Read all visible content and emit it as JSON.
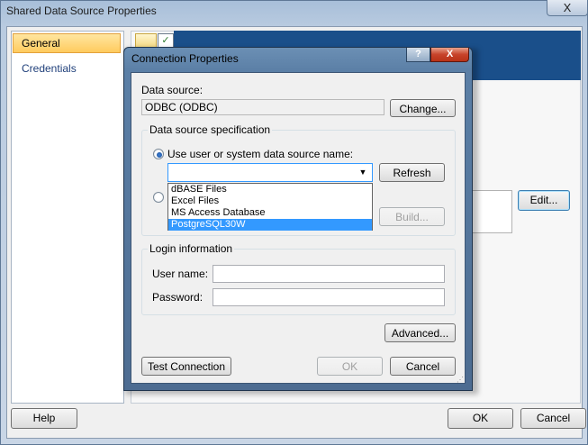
{
  "outer": {
    "title": "Shared Data Source Properties",
    "close_glyph": "X",
    "nav": {
      "general": "General",
      "credentials": "Credentials"
    },
    "edit_label": "Edit...",
    "help_label": "Help",
    "ok_label": "OK",
    "cancel_label": "Cancel"
  },
  "dialog": {
    "title": "Connection Properties",
    "help_glyph": "?",
    "close_glyph": "X",
    "data_source_label": "Data source:",
    "data_source_value": "ODBC (ODBC)",
    "change_label": "Change...",
    "spec_group_title": "Data source specification",
    "radio_dsn_label": "Use user or system data source name:",
    "dsn_selected_value": "",
    "dsn_options": [
      "dBASE Files",
      "Excel Files",
      "MS Access Database",
      "PostgreSQL30W"
    ],
    "dsn_highlighted_index": 3,
    "refresh_label": "Refresh",
    "build_label": "Build...",
    "login_group_title": "Login information",
    "username_label": "User name:",
    "password_label": "Password:",
    "username_value": "",
    "password_value": "",
    "advanced_label": "Advanced...",
    "test_label": "Test Connection",
    "ok_label": "OK",
    "cancel_label": "Cancel",
    "ok_enabled": false
  },
  "colors": {
    "selection": "#3399ff",
    "nav_selected": "#ffcb5e",
    "dialog_frame": "#5b7fa6"
  },
  "icons": [
    "close-icon",
    "help-icon",
    "dropdown-arrow-icon",
    "resize-grip-icon",
    "toolbar-icon",
    "checkbox-icon"
  ]
}
